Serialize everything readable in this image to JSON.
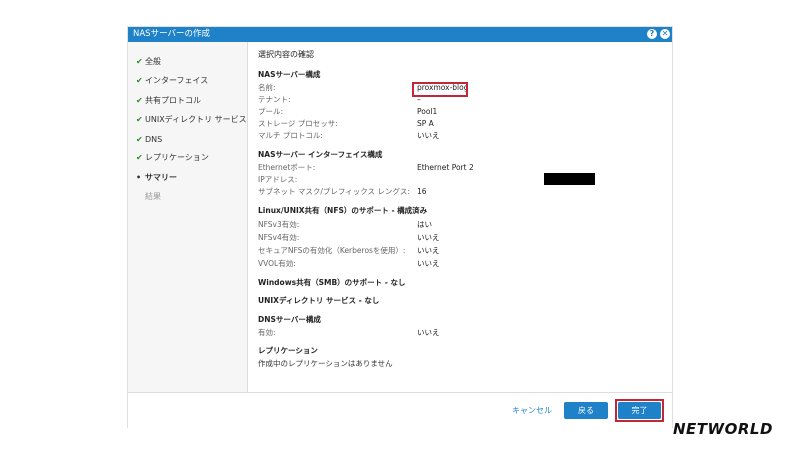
{
  "window": {
    "title": "NASサーバーの作成",
    "help_glyph": "?",
    "close_glyph": "✕"
  },
  "sidebar": {
    "items": [
      {
        "label": "全般",
        "mark": "✔",
        "state": "done"
      },
      {
        "label": "インターフェイス",
        "mark": "✔",
        "state": "done"
      },
      {
        "label": "共有プロトコル",
        "mark": "✔",
        "state": "done"
      },
      {
        "label": "UNIXディレクトリ サービス",
        "mark": "✔",
        "state": "done"
      },
      {
        "label": "DNS",
        "mark": "✔",
        "state": "done"
      },
      {
        "label": "レプリケーション",
        "mark": "✔",
        "state": "done"
      },
      {
        "label": "サマリー",
        "mark": "•",
        "state": "current"
      },
      {
        "label": "結果",
        "mark": "",
        "state": "pending"
      }
    ]
  },
  "summary": {
    "heading": "選択内容の確認",
    "nas": {
      "title": "NASサーバー構成",
      "rows": [
        {
          "label": "名前:",
          "value": "proxmox-blog"
        },
        {
          "label": "テナント:",
          "value": "–"
        },
        {
          "label": "プール:",
          "value": "Pool1"
        },
        {
          "label": "ストレージ プロセッサ:",
          "value": "SP A"
        },
        {
          "label": "マルチ プロトコル:",
          "value": "いいえ"
        }
      ]
    },
    "interface": {
      "title": "NASサーバー インターフェイス構成",
      "rows": [
        {
          "label": "Ethernetポート:",
          "value": "Ethernet Port 2"
        },
        {
          "label": "IPアドレス:",
          "value": ""
        },
        {
          "label": "サブネット マスク/プレフィックス レングス:",
          "value": "16"
        }
      ]
    },
    "nfs": {
      "title": "Linux/UNIX共有（NFS）のサポート - 構成済み",
      "rows": [
        {
          "label": "NFSv3有効:",
          "value": "はい"
        },
        {
          "label": "NFSv4有効:",
          "value": "いいえ"
        },
        {
          "label": "セキュアNFSの有効化（Kerberosを使用）:",
          "value": "いいえ"
        },
        {
          "label": "VVOL有効:",
          "value": "いいえ"
        }
      ]
    },
    "smb": {
      "title": "Windows共有（SMB）のサポート - なし"
    },
    "unix_dir": {
      "title": "UNIXディレクトリ サービス - なし"
    },
    "dns": {
      "title": "DNSサーバー構成",
      "rows": [
        {
          "label": "有効:",
          "value": "いいえ"
        }
      ]
    },
    "replication": {
      "title": "レプリケーション",
      "note": "作成中のレプリケーションはありません"
    }
  },
  "footer": {
    "cancel_label": "キャンセル",
    "back_label": "戻る",
    "finish_label": "完了"
  },
  "brand": {
    "logo_text": "NETWORLD"
  },
  "colors": {
    "titlebar": "#1f82c8",
    "button": "#1f82c8",
    "highlight": "#c0283a",
    "check": "#2a8a2a"
  }
}
